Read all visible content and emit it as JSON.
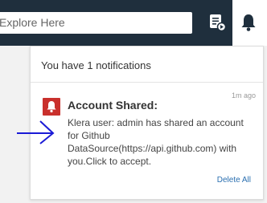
{
  "search": {
    "placeholder": "Explore Here"
  },
  "header": {
    "feed_icon": "feed-icon",
    "bell_icon": "bell-icon"
  },
  "panel": {
    "title": "You have 1 notifications",
    "notification": {
      "time": "1m ago",
      "title": "Account Shared:",
      "body": "Klera user: admin has shared an account for Github DataSource(https://api.github.com) with you.Click to accept.",
      "icon": "bell-icon",
      "icon_color": "#c9302c"
    },
    "delete_all": "Delete All"
  },
  "colors": {
    "topbar": "#1f2f3d",
    "link": "#2a6fb0",
    "annotation_arrow": "#1a1ad6"
  }
}
